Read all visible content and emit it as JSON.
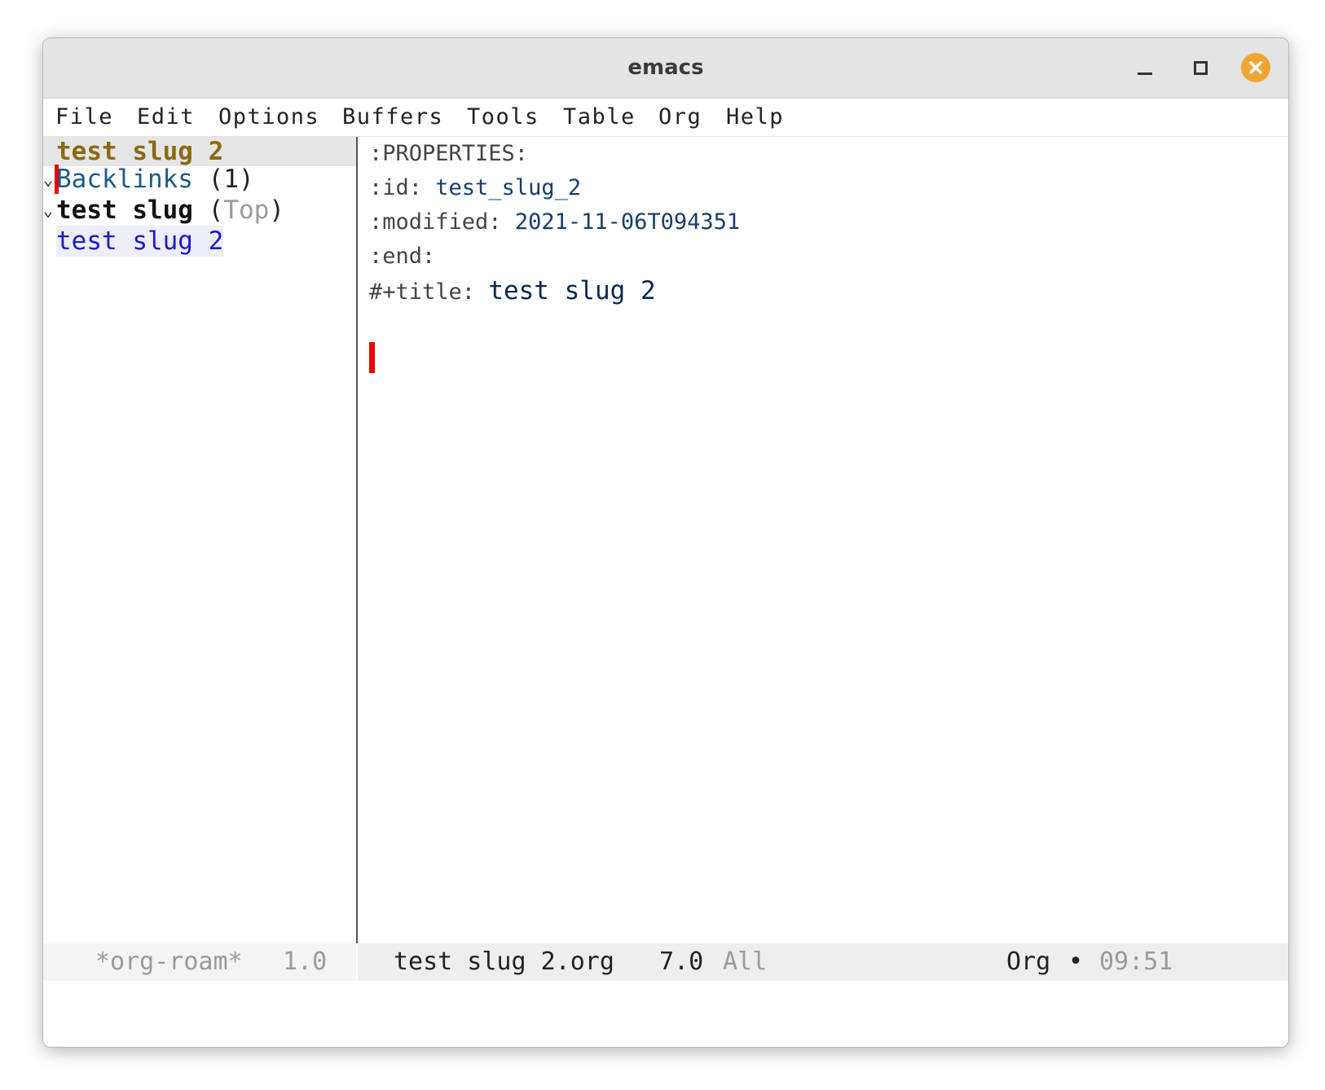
{
  "window": {
    "title": "emacs"
  },
  "menu": {
    "items": [
      "File",
      "Edit",
      "Options",
      "Buffers",
      "Tools",
      "Table",
      "Org",
      "Help"
    ]
  },
  "sidebar": {
    "header": "test slug 2",
    "backlinks_label": "Backlinks",
    "backlinks_count": "(1)",
    "source_title": "test slug",
    "source_location_open": "(",
    "source_location": "Top",
    "source_location_close": ")",
    "link_text": "test slug 2",
    "fold_glyph": "⌄"
  },
  "editor": {
    "properties_drawer": ":PROPERTIES:",
    "id_key": ":id:",
    "id_value": "test_slug_2",
    "modified_key": ":modified:",
    "modified_value": "2021-11-06T094351",
    "end_key": ":end:",
    "title_key": "#+title:",
    "title_value": "test slug 2"
  },
  "modeline_left": {
    "buffer": "*org-roam*",
    "position": "1.0"
  },
  "modeline_right": {
    "buffer": "test slug 2.org",
    "position": "7.0",
    "scroll": "All",
    "mode": "Org",
    "separator": "•",
    "time": "09:51"
  },
  "colors": {
    "header": "#8b6914",
    "backlinks": "#1f5a85",
    "link": "#1a1acd",
    "muted": "#9a9a9a",
    "cursor": "#ee0000",
    "close_button": "#f0a532"
  }
}
